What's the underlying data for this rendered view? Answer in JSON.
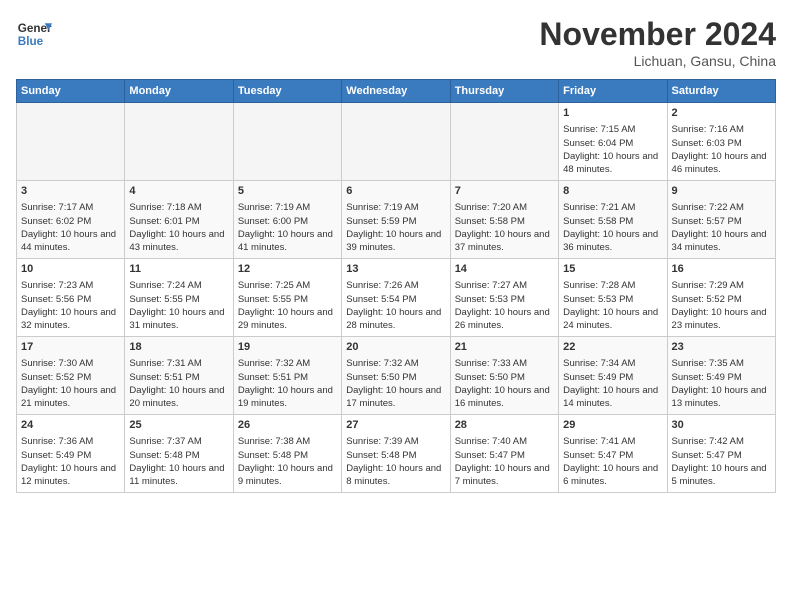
{
  "header": {
    "logo_line1": "General",
    "logo_line2": "Blue",
    "month": "November 2024",
    "location": "Lichuan, Gansu, China"
  },
  "weekdays": [
    "Sunday",
    "Monday",
    "Tuesday",
    "Wednesday",
    "Thursday",
    "Friday",
    "Saturday"
  ],
  "weeks": [
    [
      {
        "day": "",
        "empty": true
      },
      {
        "day": "",
        "empty": true
      },
      {
        "day": "",
        "empty": true
      },
      {
        "day": "",
        "empty": true
      },
      {
        "day": "",
        "empty": true
      },
      {
        "day": "1",
        "sunrise": "7:15 AM",
        "sunset": "6:04 PM",
        "daylight": "10 hours and 48 minutes."
      },
      {
        "day": "2",
        "sunrise": "7:16 AM",
        "sunset": "6:03 PM",
        "daylight": "10 hours and 46 minutes."
      }
    ],
    [
      {
        "day": "3",
        "sunrise": "7:17 AM",
        "sunset": "6:02 PM",
        "daylight": "10 hours and 44 minutes."
      },
      {
        "day": "4",
        "sunrise": "7:18 AM",
        "sunset": "6:01 PM",
        "daylight": "10 hours and 43 minutes."
      },
      {
        "day": "5",
        "sunrise": "7:19 AM",
        "sunset": "6:00 PM",
        "daylight": "10 hours and 41 minutes."
      },
      {
        "day": "6",
        "sunrise": "7:19 AM",
        "sunset": "5:59 PM",
        "daylight": "10 hours and 39 minutes."
      },
      {
        "day": "7",
        "sunrise": "7:20 AM",
        "sunset": "5:58 PM",
        "daylight": "10 hours and 37 minutes."
      },
      {
        "day": "8",
        "sunrise": "7:21 AM",
        "sunset": "5:58 PM",
        "daylight": "10 hours and 36 minutes."
      },
      {
        "day": "9",
        "sunrise": "7:22 AM",
        "sunset": "5:57 PM",
        "daylight": "10 hours and 34 minutes."
      }
    ],
    [
      {
        "day": "10",
        "sunrise": "7:23 AM",
        "sunset": "5:56 PM",
        "daylight": "10 hours and 32 minutes."
      },
      {
        "day": "11",
        "sunrise": "7:24 AM",
        "sunset": "5:55 PM",
        "daylight": "10 hours and 31 minutes."
      },
      {
        "day": "12",
        "sunrise": "7:25 AM",
        "sunset": "5:55 PM",
        "daylight": "10 hours and 29 minutes."
      },
      {
        "day": "13",
        "sunrise": "7:26 AM",
        "sunset": "5:54 PM",
        "daylight": "10 hours and 28 minutes."
      },
      {
        "day": "14",
        "sunrise": "7:27 AM",
        "sunset": "5:53 PM",
        "daylight": "10 hours and 26 minutes."
      },
      {
        "day": "15",
        "sunrise": "7:28 AM",
        "sunset": "5:53 PM",
        "daylight": "10 hours and 24 minutes."
      },
      {
        "day": "16",
        "sunrise": "7:29 AM",
        "sunset": "5:52 PM",
        "daylight": "10 hours and 23 minutes."
      }
    ],
    [
      {
        "day": "17",
        "sunrise": "7:30 AM",
        "sunset": "5:52 PM",
        "daylight": "10 hours and 21 minutes."
      },
      {
        "day": "18",
        "sunrise": "7:31 AM",
        "sunset": "5:51 PM",
        "daylight": "10 hours and 20 minutes."
      },
      {
        "day": "19",
        "sunrise": "7:32 AM",
        "sunset": "5:51 PM",
        "daylight": "10 hours and 19 minutes."
      },
      {
        "day": "20",
        "sunrise": "7:32 AM",
        "sunset": "5:50 PM",
        "daylight": "10 hours and 17 minutes."
      },
      {
        "day": "21",
        "sunrise": "7:33 AM",
        "sunset": "5:50 PM",
        "daylight": "10 hours and 16 minutes."
      },
      {
        "day": "22",
        "sunrise": "7:34 AM",
        "sunset": "5:49 PM",
        "daylight": "10 hours and 14 minutes."
      },
      {
        "day": "23",
        "sunrise": "7:35 AM",
        "sunset": "5:49 PM",
        "daylight": "10 hours and 13 minutes."
      }
    ],
    [
      {
        "day": "24",
        "sunrise": "7:36 AM",
        "sunset": "5:49 PM",
        "daylight": "10 hours and 12 minutes."
      },
      {
        "day": "25",
        "sunrise": "7:37 AM",
        "sunset": "5:48 PM",
        "daylight": "10 hours and 11 minutes."
      },
      {
        "day": "26",
        "sunrise": "7:38 AM",
        "sunset": "5:48 PM",
        "daylight": "10 hours and 9 minutes."
      },
      {
        "day": "27",
        "sunrise": "7:39 AM",
        "sunset": "5:48 PM",
        "daylight": "10 hours and 8 minutes."
      },
      {
        "day": "28",
        "sunrise": "7:40 AM",
        "sunset": "5:47 PM",
        "daylight": "10 hours and 7 minutes."
      },
      {
        "day": "29",
        "sunrise": "7:41 AM",
        "sunset": "5:47 PM",
        "daylight": "10 hours and 6 minutes."
      },
      {
        "day": "30",
        "sunrise": "7:42 AM",
        "sunset": "5:47 PM",
        "daylight": "10 hours and 5 minutes."
      }
    ]
  ],
  "labels": {
    "sunrise_prefix": "Sunrise: ",
    "sunset_prefix": "Sunset: ",
    "daylight_prefix": "Daylight: "
  }
}
